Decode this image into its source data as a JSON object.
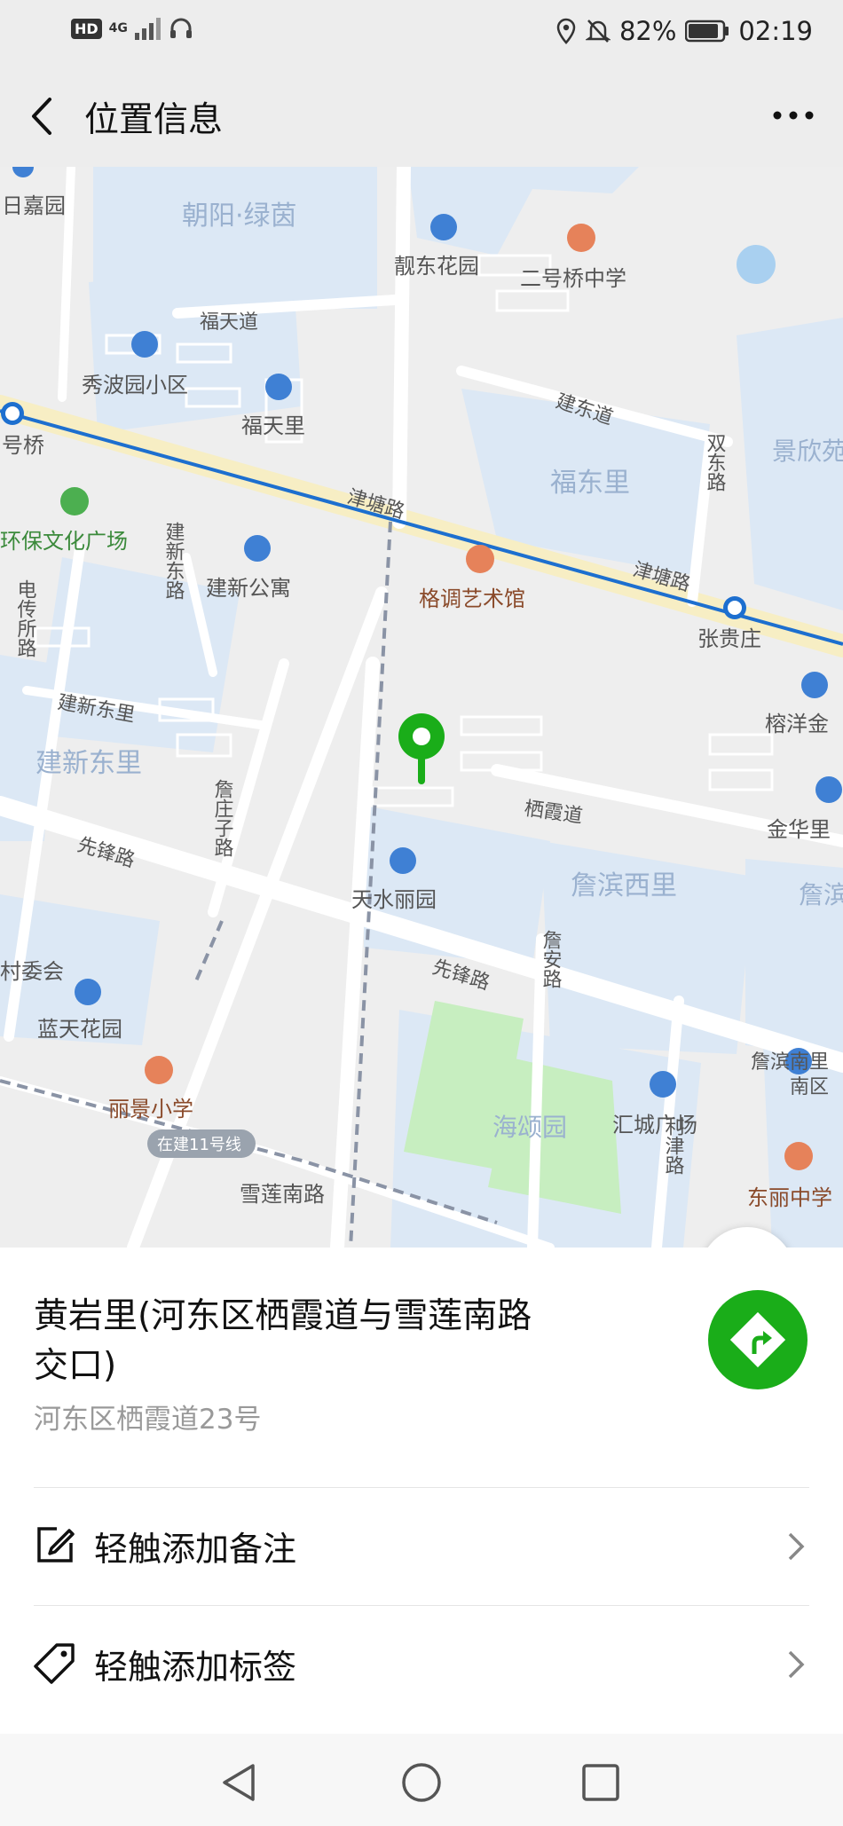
{
  "status_bar": {
    "hd": "HD",
    "network": "4G",
    "battery": "82%",
    "time": "02:19"
  },
  "header": {
    "title": "位置信息"
  },
  "map": {
    "labels": {
      "chaoyang_lvyin": "朝阳·绿茵",
      "riji_jiayuan": "日嘉园",
      "liangdong_huayuan": "靓东花园",
      "erhaoqiao_school": "二号桥中学",
      "futian_dao": "福天道",
      "xiubo_garden": "秀波园小区",
      "futianli": "福天里",
      "jiandong_road": "建东道",
      "shuangdong_road": "双东路",
      "jingxin": "景欣苑",
      "haoqiao": "号桥",
      "fudongli": "福东里",
      "jintang_road_1": "津塘路",
      "jintang_road_2": "津塘路",
      "huanbao_square": "环保文化广场",
      "jianxin_east_road": "建新东路",
      "jianxin_apartment": "建新公寓",
      "gediao_art": "格调艺术馆",
      "zhangguizhuang": "张贵庄",
      "dianchuansuo_road": "电传所路",
      "jianxin_dongli_small": "建新东里",
      "jianxin_dongli": "建新东里",
      "rongyang": "榕洋金",
      "qixia_dao": "栖霞道",
      "jinhuali": "金华里",
      "xianfeng_road_1": "先锋路",
      "zhanzhuangzi_road": "詹庄子路",
      "tianshui_garden": "天水丽园",
      "zhanbin_xili": "詹滨西里",
      "zhan": "詹滨",
      "cunweihui": "村委会",
      "zhanan_road": "詹安路",
      "xianfeng_road_2": "先锋路",
      "lantian_garden": "蓝天花园",
      "zhanbin_nanli": "詹滨南里",
      "nanqu": "南区",
      "lijing_school": "丽景小学",
      "haisong_garden": "海颂园",
      "huicheng_plaza": "汇城广场",
      "lijin_road": "利津路",
      "dongli_school": "东丽中学",
      "line11_badge": "在建11号线",
      "xuelian_south_road": "雪莲南路"
    }
  },
  "place": {
    "name": "黄岩里(河东区栖霞道与雪莲南路交口)",
    "address": "河东区栖霞道23号"
  },
  "actions": [
    {
      "label": "轻触添加备注",
      "icon": "edit-icon"
    },
    {
      "label": "轻触添加标签",
      "icon": "tag-icon"
    }
  ],
  "colors": {
    "accent_green": "#1aad19",
    "metro_line": "#1d6fcf",
    "block_blue": "#dbe7f5"
  }
}
